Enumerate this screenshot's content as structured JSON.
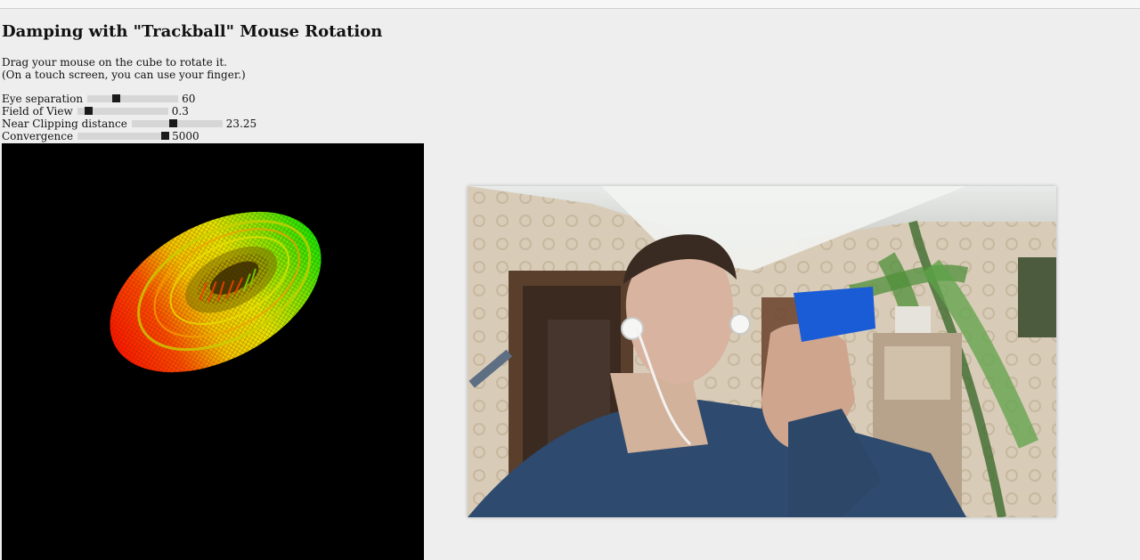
{
  "page": {
    "title": "Damping with \"Trackball\" Mouse Rotation",
    "instructions": [
      "Drag your mouse on the cube to rotate it.",
      "(On a touch screen, you can use your finger.)"
    ]
  },
  "controls": [
    {
      "name": "eye-separation",
      "label": "Eye separation",
      "value": "60",
      "fraction": 0.31
    },
    {
      "name": "field-of-view",
      "label": "Field of View",
      "value": "0.3",
      "fraction": 0.12
    },
    {
      "name": "near-clipping-distance",
      "label": "Near Clipping distance",
      "value": "23.25",
      "fraction": 0.45
    },
    {
      "name": "convergence",
      "label": "Convergence",
      "value": "5000",
      "fraction": 0.96
    }
  ],
  "scene": {
    "object": "wireframe-torus",
    "background": "#000000",
    "left_color": "#ff1a00",
    "center_color": "#f0e000",
    "right_color": "#22ee00"
  },
  "video": {
    "content": "webcam-feed"
  }
}
